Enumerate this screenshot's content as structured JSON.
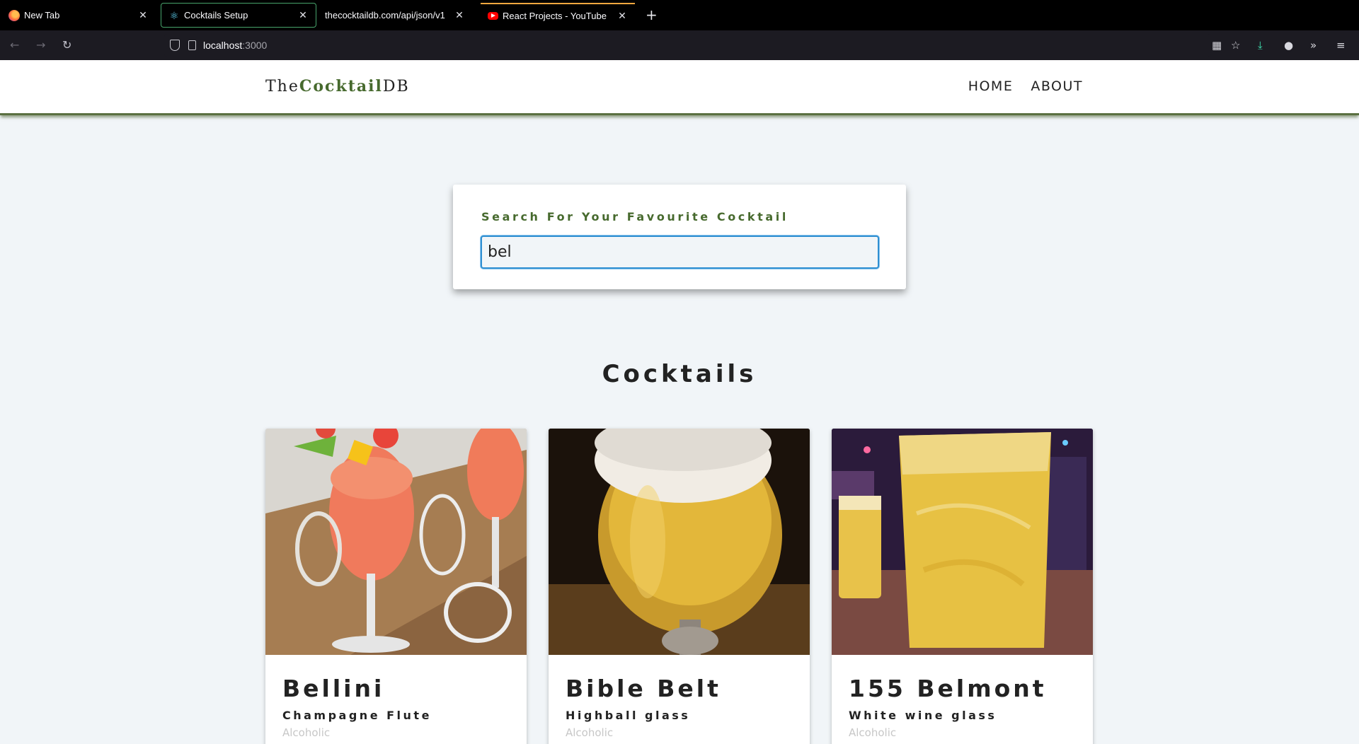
{
  "browser": {
    "tabs": [
      {
        "title": "New Tab",
        "favicon": "firefox-icon",
        "active": false
      },
      {
        "title": "Cocktails Setup",
        "favicon": "react-icon",
        "active": true
      },
      {
        "title": "thecocktaildb.com/api/json/v1",
        "favicon": "none",
        "active": false
      },
      {
        "title": "React Projects - YouTube",
        "favicon": "youtube-icon",
        "active": false,
        "playing": true
      }
    ],
    "url_host": "localhost",
    "url_port": ":3000"
  },
  "site": {
    "logo_prefix": "The",
    "logo_accent": "Cocktail",
    "logo_suffix": "DB",
    "nav_links": [
      "Home",
      "About"
    ],
    "accent_color": "#476a2e"
  },
  "search": {
    "label": "Search For Your Favourite Cocktail",
    "value": "bel"
  },
  "section_title": "Cocktails",
  "cocktails": [
    {
      "name": "Bellini",
      "glass": "Champagne Flute",
      "type": "Alcoholic"
    },
    {
      "name": "Bible Belt",
      "glass": "Highball glass",
      "type": "Alcoholic"
    },
    {
      "name": "155 Belmont",
      "glass": "White wine glass",
      "type": "Alcoholic"
    }
  ]
}
